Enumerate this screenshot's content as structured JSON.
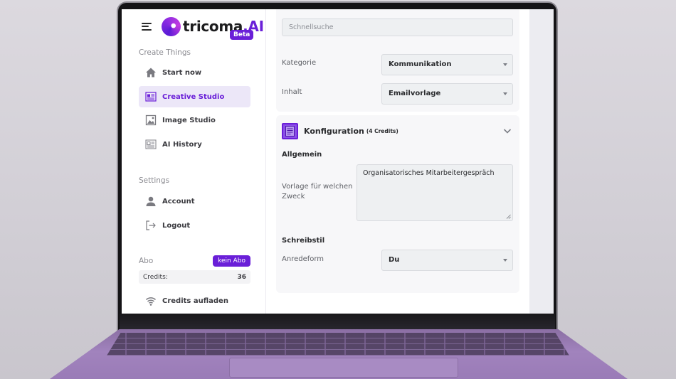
{
  "brand": {
    "name": "tricoma",
    "suffix": ".AI",
    "badge": "Beta",
    "accent_color": "#6a1fd8"
  },
  "sidebar": {
    "create_title": "Create Things",
    "create_items": [
      {
        "label": "Start now",
        "icon": "home-icon",
        "active": false
      },
      {
        "label": "Creative Studio",
        "icon": "document-icon",
        "active": true
      },
      {
        "label": "Image Studio",
        "icon": "image-icon",
        "active": false
      },
      {
        "label": "AI History",
        "icon": "history-document-icon",
        "active": false
      }
    ],
    "settings_title": "Settings",
    "settings_items": [
      {
        "label": "Account",
        "icon": "user-icon"
      },
      {
        "label": "Logout",
        "icon": "logout-icon"
      }
    ],
    "abo": {
      "label": "Abo",
      "badge": "kein Abo",
      "credits_label": "Credits:",
      "credits_value": "36"
    },
    "credits_topup": {
      "label": "Credits aufladen",
      "icon": "wifi-signal-icon"
    }
  },
  "main": {
    "search": {
      "placeholder": "Schnellsuche"
    },
    "category": {
      "label": "Kategorie",
      "value": "Kommunikation"
    },
    "content": {
      "label": "Inhalt",
      "value": "Emailvorlage"
    },
    "config": {
      "title": "Konfiguration",
      "credits": "(4 Credits)",
      "general_title": "Allgemein",
      "purpose_label_line1": "Vorlage für welchen",
      "purpose_label_line2": "Zweck",
      "purpose_value": "Organisatorisches Mitarbeitergespräch",
      "style_title": "Schreibstil",
      "salutation_label": "Anredeform",
      "salutation_value": "Du"
    }
  }
}
